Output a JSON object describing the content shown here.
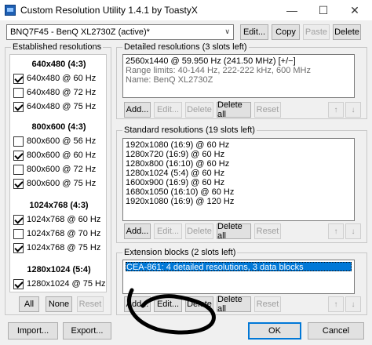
{
  "window": {
    "title": "Custom Resolution Utility 1.4.1 by ToastyX",
    "minimize": "—",
    "maximize": "☐",
    "close": "✕"
  },
  "monitor": {
    "selected": "BNQ7F45 - BenQ XL2730Z (active)*",
    "buttons": {
      "edit": "Edit...",
      "copy": "Copy",
      "paste": "Paste",
      "delete": "Delete"
    }
  },
  "established": {
    "label": "Established resolutions",
    "groups": [
      {
        "header": "640x480 (4:3)",
        "items": [
          {
            "label": "640x480 @ 60 Hz",
            "checked": true
          },
          {
            "label": "640x480 @ 72 Hz",
            "checked": false
          },
          {
            "label": "640x480 @ 75 Hz",
            "checked": true
          }
        ]
      },
      {
        "header": "800x600 (4:3)",
        "items": [
          {
            "label": "800x600 @ 56 Hz",
            "checked": false
          },
          {
            "label": "800x600 @ 60 Hz",
            "checked": true
          },
          {
            "label": "800x600 @ 72 Hz",
            "checked": false
          },
          {
            "label": "800x600 @ 75 Hz",
            "checked": true
          }
        ]
      },
      {
        "header": "1024x768 (4:3)",
        "items": [
          {
            "label": "1024x768 @ 60 Hz",
            "checked": true
          },
          {
            "label": "1024x768 @ 70 Hz",
            "checked": false
          },
          {
            "label": "1024x768 @ 75 Hz",
            "checked": true
          }
        ]
      },
      {
        "header": "1280x1024 (5:4)",
        "items": [
          {
            "label": "1280x1024 @ 75 Hz",
            "checked": true
          }
        ]
      }
    ],
    "buttons": {
      "all": "All",
      "none": "None",
      "reset": "Reset"
    }
  },
  "detailed": {
    "label": "Detailed resolutions (3 slots left)",
    "lines": [
      "2560x1440 @ 59.950 Hz (241.50 MHz) [+/−]",
      "Range limits: 40-144 Hz, 222-222 kHz, 600 MHz",
      "Name: BenQ XL2730Z"
    ],
    "buttons": {
      "add": "Add...",
      "edit": "Edit...",
      "delete": "Delete",
      "delete_all": "Delete all",
      "reset": "Reset"
    }
  },
  "standard": {
    "label": "Standard resolutions (19 slots left)",
    "lines": [
      "1920x1080 (16:9) @ 60 Hz",
      "1280x720 (16:9) @ 60 Hz",
      "1280x800 (16:10) @ 60 Hz",
      "1280x1024 (5:4) @ 60 Hz",
      "1600x900 (16:9) @ 60 Hz",
      "1680x1050 (16:10) @ 60 Hz",
      "1920x1080 (16:9) @ 120 Hz"
    ],
    "buttons": {
      "add": "Add...",
      "edit": "Edit...",
      "delete": "Delete",
      "delete_all": "Delete all",
      "reset": "Reset"
    }
  },
  "extension": {
    "label": "Extension blocks (2 slots left)",
    "lines": [
      "CEA-861: 4 detailed resolutions, 3 data blocks"
    ],
    "buttons": {
      "add": "Add...",
      "edit": "Edit...",
      "delete": "Delete",
      "delete_all": "Delete all",
      "reset": "Reset"
    }
  },
  "footer": {
    "import": "Import...",
    "export": "Export...",
    "ok": "OK",
    "cancel": "Cancel"
  },
  "icons": {
    "up": "↑",
    "down": "↓",
    "combo": "∨"
  }
}
